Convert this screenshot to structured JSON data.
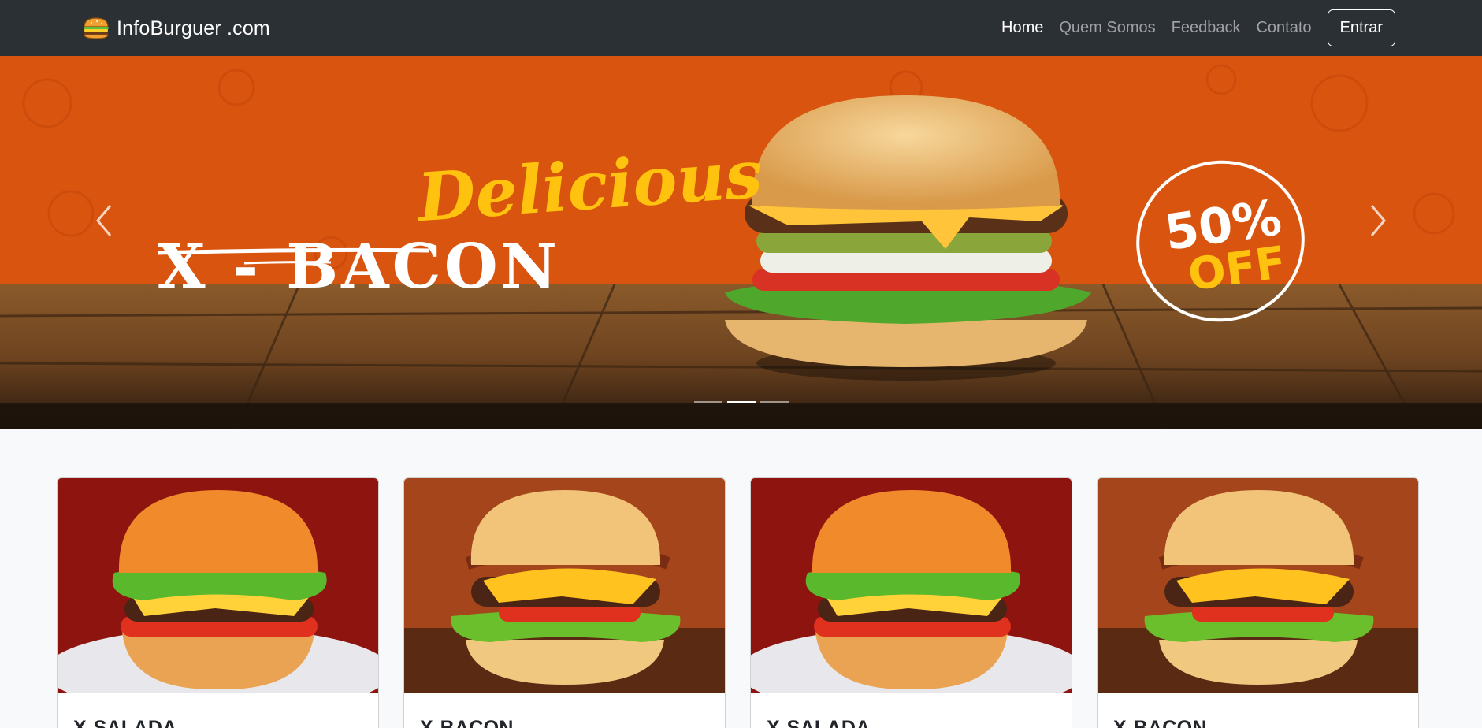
{
  "navbar": {
    "brand": "InfoBurguer .com",
    "brand_icon": "burger-icon",
    "links": [
      {
        "label": "Home",
        "active": true
      },
      {
        "label": "Quem Somos",
        "active": false
      },
      {
        "label": "Feedback",
        "active": false
      },
      {
        "label": "Contato",
        "active": false
      }
    ],
    "login_label": "Entrar"
  },
  "hero": {
    "headline_script": "Delicious",
    "headline": "X - BACON",
    "promo_value": "50%",
    "promo_word": "OFF",
    "slides_total": 3,
    "active_slide": 1,
    "prev_icon": "chevron-left-icon",
    "next_icon": "chevron-right-icon",
    "colors": {
      "orange": "#d9540f",
      "yellow": "#ffc20e"
    }
  },
  "cards": [
    {
      "title": "X-SALADA",
      "variant": "salada"
    },
    {
      "title": "X-BACON",
      "variant": "bacon"
    },
    {
      "title": "X-SALADA",
      "variant": "salada"
    },
    {
      "title": "X-BACON",
      "variant": "bacon"
    }
  ]
}
